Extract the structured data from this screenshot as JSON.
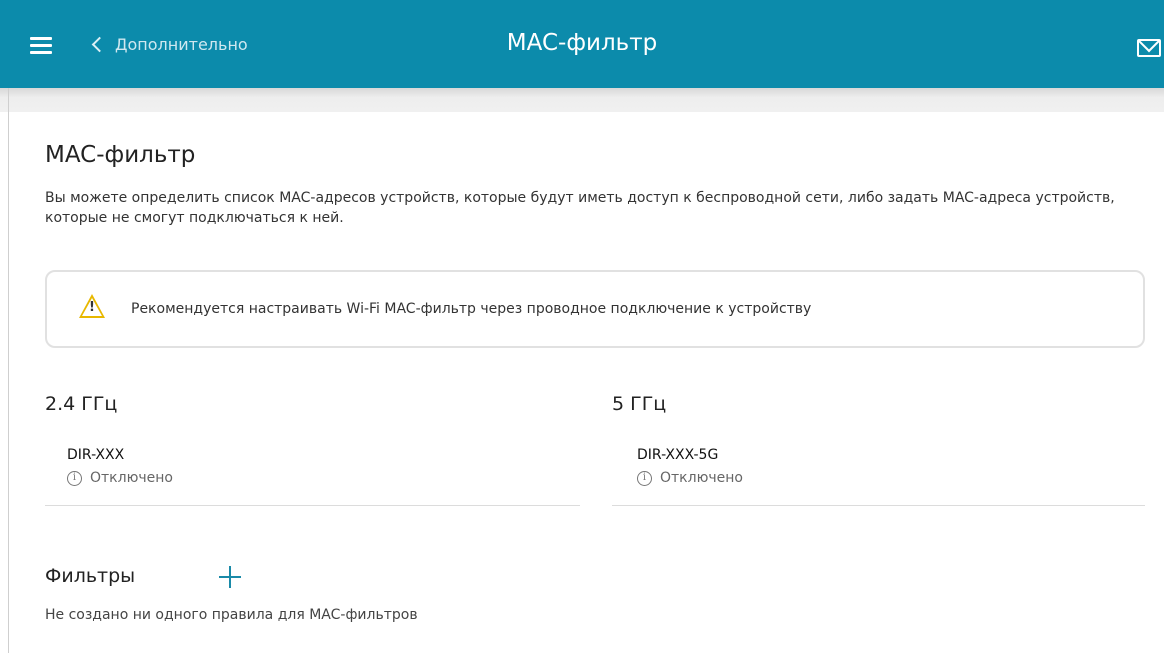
{
  "header": {
    "back_label": "Дополнительно",
    "title": "MAC-фильтр",
    "menu_icon": "hamburger-icon",
    "mail_icon": "envelope-icon",
    "bar_color": "#0c8bab"
  },
  "page": {
    "heading": "MAC-фильтр",
    "description": "Вы можете определить список MAC-адресов устройств, которые будут иметь доступ к беспроводной сети, либо задать MAC-адреса устройств, которые не смогут подключаться к ней."
  },
  "warning": {
    "icon": "warning-triangle-icon",
    "text": "Рекомендуется настраивать Wi-Fi MAC-фильтр через проводное подключение к устройству"
  },
  "bands": [
    {
      "heading": "2.4 ГГц",
      "network": "DIR-XXX",
      "status": "Отключено"
    },
    {
      "heading": "5 ГГц",
      "network": "DIR-XXX-5G",
      "status": "Отключено"
    }
  ],
  "filters": {
    "heading": "Фильтры",
    "empty_text": "Не создано ни одного правила для MAC-фильтров",
    "add_icon": "plus-icon",
    "accent": "#1a8aa8"
  }
}
